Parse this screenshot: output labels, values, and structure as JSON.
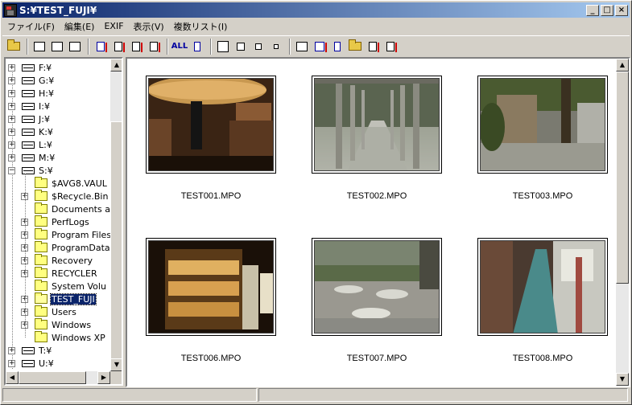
{
  "window": {
    "title": "S:¥TEST_FUJI¥",
    "minimize": "_",
    "maximize": "□",
    "close": "×"
  },
  "menu": [
    "ファイル(F)",
    "編集(E)",
    "EXIF",
    "表示(V)",
    "複数リスト(I)"
  ],
  "toolbar": {
    "all_label": "ALL"
  },
  "tree": {
    "drives": [
      {
        "label": "F:¥",
        "expander": "+"
      },
      {
        "label": "G:¥",
        "expander": "+"
      },
      {
        "label": "H:¥",
        "expander": "+"
      },
      {
        "label": "I:¥",
        "expander": "+"
      },
      {
        "label": "J:¥",
        "expander": "+"
      },
      {
        "label": "K:¥",
        "expander": "+"
      },
      {
        "label": "L:¥",
        "expander": "+"
      },
      {
        "label": "M:¥",
        "expander": "+"
      },
      {
        "label": "S:¥",
        "expander": "−"
      }
    ],
    "folders": [
      {
        "label": "$AVG8.VAUL",
        "expander": ""
      },
      {
        "label": "$Recycle.Bin",
        "expander": "+"
      },
      {
        "label": "Documents a",
        "expander": ""
      },
      {
        "label": "PerfLogs",
        "expander": "+"
      },
      {
        "label": "Program Files",
        "expander": "+"
      },
      {
        "label": "ProgramData",
        "expander": "+"
      },
      {
        "label": "Recovery",
        "expander": "+"
      },
      {
        "label": "RECYCLER",
        "expander": "+"
      },
      {
        "label": "System Volu",
        "expander": ""
      },
      {
        "label": "TEST_FUJI",
        "expander": "+"
      },
      {
        "label": "Users",
        "expander": "+"
      },
      {
        "label": "Windows",
        "expander": "+"
      },
      {
        "label": "Windows XP",
        "expander": ""
      }
    ],
    "bottom_drives": [
      {
        "label": "T:¥",
        "expander": "+"
      },
      {
        "label": "U:¥",
        "expander": "+"
      }
    ],
    "selected": "TEST_FUJI"
  },
  "gallery": {
    "items": [
      {
        "caption": "TEST001.MPO"
      },
      {
        "caption": "TEST002.MPO"
      },
      {
        "caption": "TEST003.MPO"
      },
      {
        "caption": "TEST006.MPO"
      },
      {
        "caption": "TEST007.MPO"
      },
      {
        "caption": "TEST008.MPO"
      }
    ]
  }
}
